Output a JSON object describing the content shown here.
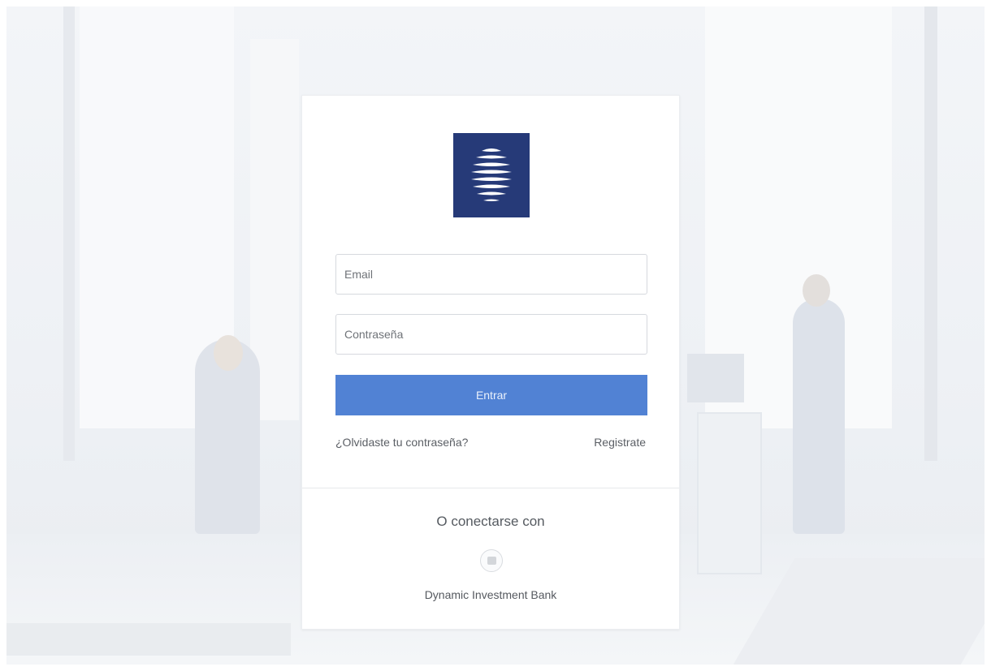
{
  "brand": {
    "logo_color": "#263a78",
    "logo_icon": "striped-globe-icon"
  },
  "form": {
    "email_placeholder": "Email",
    "password_placeholder": "Contraseña",
    "submit_label": "Entrar",
    "submit_color": "#5182d4"
  },
  "links": {
    "forgot_password": "¿Olvidaste tu contraseña?",
    "register": "Registrate"
  },
  "social": {
    "heading": "O conectarse con",
    "provider_icon": "bank-icon",
    "provider_name": "Dynamic Investment Bank"
  }
}
